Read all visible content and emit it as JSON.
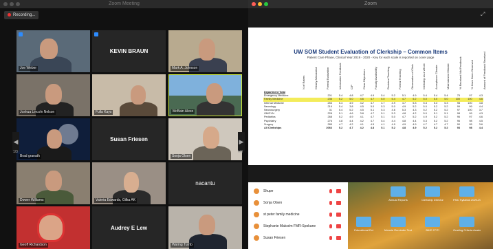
{
  "left_window": {
    "title": "Zoom Meeting",
    "recording_label": "Recording...",
    "page_left": "1/3",
    "page_right": "1/3"
  },
  "tiles": [
    {
      "name": "Joe Weber"
    },
    {
      "name": "KEVIN BRAUN"
    },
    {
      "name": "Mark A. Johnson"
    },
    {
      "name": "Joshua Lincoln Nelson"
    },
    {
      "name": "Fulla Kays"
    },
    {
      "name": "McBain Alexo"
    },
    {
      "name": "Brad granath"
    },
    {
      "name": "Susan Friesen"
    },
    {
      "name": "Sonja Olsen"
    },
    {
      "name": "Dower Williams"
    },
    {
      "name": "Valeria Edwards, Gilka AK"
    },
    {
      "name": "nacantu"
    },
    {
      "name": "Geoff Richardson"
    },
    {
      "name": "Audrey E Lew"
    },
    {
      "name": "Waring Turnb"
    }
  ],
  "share_window": {
    "title": "Zoom",
    "slide_title": "UW SOM Student Evaluation of Clerkship – Common Items",
    "slide_subtitle": "Patient Care Phase, Clinical Year 2019 - 2020 - Key for each scale is reported on cover page",
    "col_headers": [
      "N of Raters",
      "Clearly Articulated",
      "Formal Evaluation",
      "Informative Feedback",
      "CIP",
      "Clear Objectives",
      "Faculty Availability",
      "Resident Teaching",
      "Formal Teaching",
      "Observation of Clinic",
      "Clerkship as a Whole",
      "Acceptance Climate",
      "Mistreatment Climate",
      "% Received Mid Feedback",
      "% Have Been Observed",
      "Amount of Feedback Received"
    ],
    "first_header": "Department Total",
    "rows": [
      {
        "label": "Emergency Medicine",
        "vals": [
          "201",
          "5.4",
          "4.8",
          "4.7",
          "4.9",
          "5.4",
          "5.2",
          "5.1",
          "4.9",
          "5.4",
          "5.4",
          "5.4",
          "75",
          "97",
          "4.3"
        ],
        "hl": false
      },
      {
        "label": "Family Medicine",
        "vals": [
          "236",
          "5.2",
          "5.0",
          "4.6",
          "4.7",
          "5.0",
          "5.4",
          "4.7",
          "5.2",
          "5.0",
          "5.0",
          "5.0",
          "100",
          "100",
          "4.6"
        ],
        "hl": true
      },
      {
        "label": "Internal Medicine",
        "vals": [
          "253",
          "5.4",
          "4.9",
          "4.2",
          "4.7",
          "4.7",
          "4.9",
          "4.7",
          "5.3",
          "5.3",
          "5.3",
          "5.3",
          "98",
          "100",
          "4.8"
        ],
        "hl": false
      },
      {
        "label": "Neurology",
        "vals": [
          "219",
          "5.4",
          "3.8",
          "4.5",
          "5.0",
          "5.3",
          "5.0",
          "4.9",
          "5.2",
          "5.0",
          "5.2",
          "5.2",
          "99",
          "99",
          "4.4"
        ],
        "hl": false
      },
      {
        "label": "Neurosurgery",
        "vals": [
          "31",
          "5.4",
          "5.2",
          "4.5",
          "5.1",
          "5.3",
          "4.6",
          "5.3",
          "4.3",
          "5.2",
          "5.2",
          "5.2",
          "97",
          "100",
          "3.7"
        ],
        "hl": false
      },
      {
        "label": "OB/GYN",
        "vals": [
          "228",
          "5.1",
          "4.6",
          "3.8",
          "4.7",
          "5.1",
          "5.3",
          "4.8",
          "4.2",
          "5.0",
          "5.1",
          "5.1",
          "98",
          "99",
          "4.3"
        ],
        "hl": false
      },
      {
        "label": "Pediatrics",
        "vals": [
          "268",
          "5.2",
          "4.9",
          "4.1",
          "4.7",
          "5.1",
          "5.0",
          "4.7",
          "5.2",
          "4.9",
          "5.2",
          "5.2",
          "96",
          "97",
          "4.6"
        ],
        "hl": false
      },
      {
        "label": "Psychiatry",
        "vals": [
          "276",
          "4.8",
          "4.4",
          "4.2",
          "4.7",
          "5.4",
          "4.4",
          "4.8",
          "4.4",
          "5.3",
          "5.2",
          "5.2",
          "96",
          "98",
          "4.5"
        ],
        "hl": false
      },
      {
        "label": "Surgery",
        "vals": [
          "285",
          "4.7",
          "4.2",
          "4.1",
          "4.5",
          "4.1",
          "4.9",
          "4.9",
          "4.9",
          "4.7",
          "4.7",
          "4.7",
          "90",
          "95",
          "3.6"
        ],
        "hl": false
      },
      {
        "label": "All Clerkships",
        "vals": [
          "2066",
          "5.2",
          "4.7",
          "4.2",
          "4.8",
          "5.1",
          "5.2",
          "4.8",
          "4.9",
          "5.2",
          "5.2",
          "5.2",
          "93",
          "98",
          "4.4"
        ],
        "hl": false,
        "tot": true
      }
    ]
  },
  "participants": [
    {
      "name": "Shupe"
    },
    {
      "name": "Sonja Olsen"
    },
    {
      "name": "st peter family medicine"
    },
    {
      "name": "Stephanie Malcolm FMR-Spokane"
    },
    {
      "name": "Susan Friesen"
    }
  ],
  "desktop_files": [
    "Annual Reports",
    "Clerkship Director",
    "FMC Syllabus 2020-2021.pdf",
    "Educational Ext",
    "Meanie Reminder Text",
    "BIKE 27/TI",
    "Grading Criteria Academic...2021.pdf"
  ]
}
